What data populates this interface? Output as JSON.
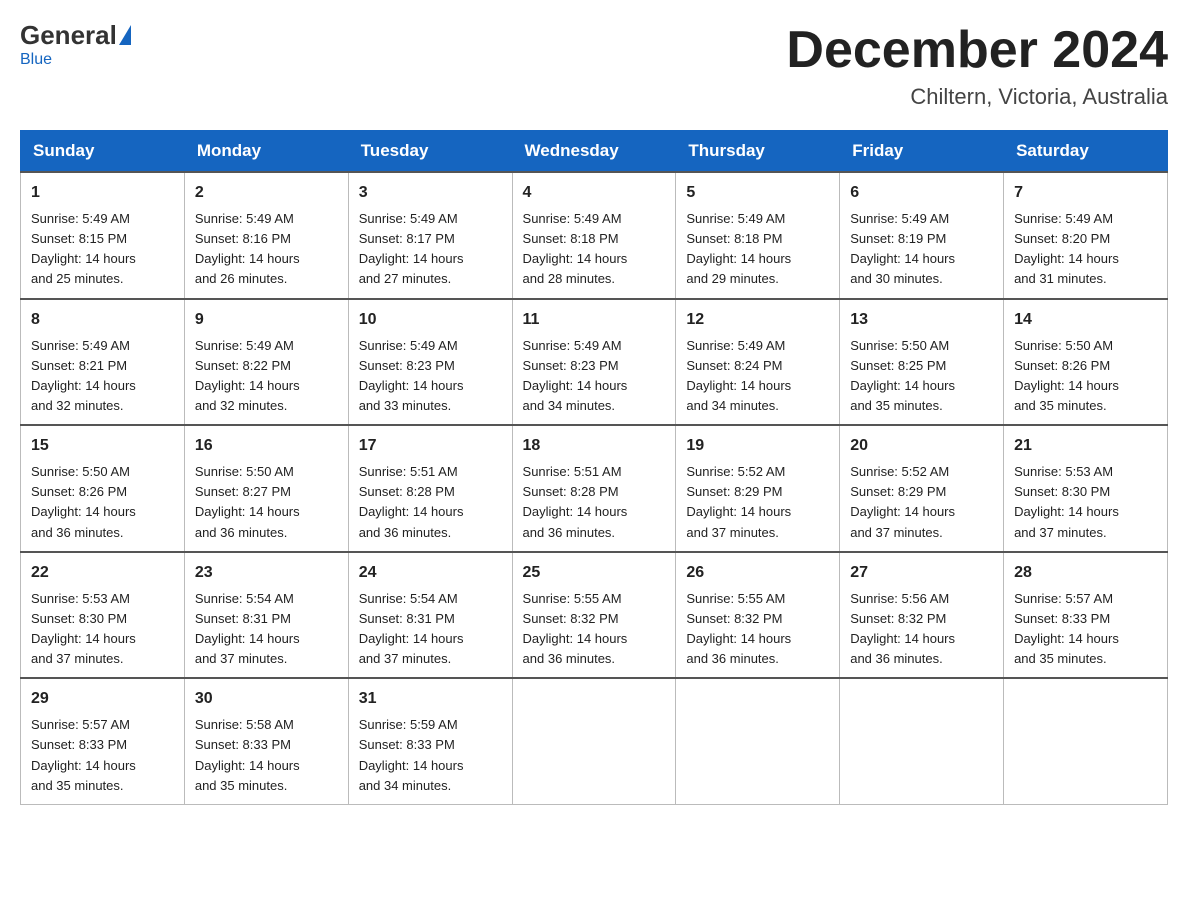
{
  "logo": {
    "general": "General",
    "blue": "Blue"
  },
  "title": "December 2024",
  "subtitle": "Chiltern, Victoria, Australia",
  "days_of_week": [
    "Sunday",
    "Monday",
    "Tuesday",
    "Wednesday",
    "Thursday",
    "Friday",
    "Saturday"
  ],
  "weeks": [
    [
      {
        "day": "1",
        "sunrise": "5:49 AM",
        "sunset": "8:15 PM",
        "daylight": "14 hours and 25 minutes."
      },
      {
        "day": "2",
        "sunrise": "5:49 AM",
        "sunset": "8:16 PM",
        "daylight": "14 hours and 26 minutes."
      },
      {
        "day": "3",
        "sunrise": "5:49 AM",
        "sunset": "8:17 PM",
        "daylight": "14 hours and 27 minutes."
      },
      {
        "day": "4",
        "sunrise": "5:49 AM",
        "sunset": "8:18 PM",
        "daylight": "14 hours and 28 minutes."
      },
      {
        "day": "5",
        "sunrise": "5:49 AM",
        "sunset": "8:18 PM",
        "daylight": "14 hours and 29 minutes."
      },
      {
        "day": "6",
        "sunrise": "5:49 AM",
        "sunset": "8:19 PM",
        "daylight": "14 hours and 30 minutes."
      },
      {
        "day": "7",
        "sunrise": "5:49 AM",
        "sunset": "8:20 PM",
        "daylight": "14 hours and 31 minutes."
      }
    ],
    [
      {
        "day": "8",
        "sunrise": "5:49 AM",
        "sunset": "8:21 PM",
        "daylight": "14 hours and 32 minutes."
      },
      {
        "day": "9",
        "sunrise": "5:49 AM",
        "sunset": "8:22 PM",
        "daylight": "14 hours and 32 minutes."
      },
      {
        "day": "10",
        "sunrise": "5:49 AM",
        "sunset": "8:23 PM",
        "daylight": "14 hours and 33 minutes."
      },
      {
        "day": "11",
        "sunrise": "5:49 AM",
        "sunset": "8:23 PM",
        "daylight": "14 hours and 34 minutes."
      },
      {
        "day": "12",
        "sunrise": "5:49 AM",
        "sunset": "8:24 PM",
        "daylight": "14 hours and 34 minutes."
      },
      {
        "day": "13",
        "sunrise": "5:50 AM",
        "sunset": "8:25 PM",
        "daylight": "14 hours and 35 minutes."
      },
      {
        "day": "14",
        "sunrise": "5:50 AM",
        "sunset": "8:26 PM",
        "daylight": "14 hours and 35 minutes."
      }
    ],
    [
      {
        "day": "15",
        "sunrise": "5:50 AM",
        "sunset": "8:26 PM",
        "daylight": "14 hours and 36 minutes."
      },
      {
        "day": "16",
        "sunrise": "5:50 AM",
        "sunset": "8:27 PM",
        "daylight": "14 hours and 36 minutes."
      },
      {
        "day": "17",
        "sunrise": "5:51 AM",
        "sunset": "8:28 PM",
        "daylight": "14 hours and 36 minutes."
      },
      {
        "day": "18",
        "sunrise": "5:51 AM",
        "sunset": "8:28 PM",
        "daylight": "14 hours and 36 minutes."
      },
      {
        "day": "19",
        "sunrise": "5:52 AM",
        "sunset": "8:29 PM",
        "daylight": "14 hours and 37 minutes."
      },
      {
        "day": "20",
        "sunrise": "5:52 AM",
        "sunset": "8:29 PM",
        "daylight": "14 hours and 37 minutes."
      },
      {
        "day": "21",
        "sunrise": "5:53 AM",
        "sunset": "8:30 PM",
        "daylight": "14 hours and 37 minutes."
      }
    ],
    [
      {
        "day": "22",
        "sunrise": "5:53 AM",
        "sunset": "8:30 PM",
        "daylight": "14 hours and 37 minutes."
      },
      {
        "day": "23",
        "sunrise": "5:54 AM",
        "sunset": "8:31 PM",
        "daylight": "14 hours and 37 minutes."
      },
      {
        "day": "24",
        "sunrise": "5:54 AM",
        "sunset": "8:31 PM",
        "daylight": "14 hours and 37 minutes."
      },
      {
        "day": "25",
        "sunrise": "5:55 AM",
        "sunset": "8:32 PM",
        "daylight": "14 hours and 36 minutes."
      },
      {
        "day": "26",
        "sunrise": "5:55 AM",
        "sunset": "8:32 PM",
        "daylight": "14 hours and 36 minutes."
      },
      {
        "day": "27",
        "sunrise": "5:56 AM",
        "sunset": "8:32 PM",
        "daylight": "14 hours and 36 minutes."
      },
      {
        "day": "28",
        "sunrise": "5:57 AM",
        "sunset": "8:33 PM",
        "daylight": "14 hours and 35 minutes."
      }
    ],
    [
      {
        "day": "29",
        "sunrise": "5:57 AM",
        "sunset": "8:33 PM",
        "daylight": "14 hours and 35 minutes."
      },
      {
        "day": "30",
        "sunrise": "5:58 AM",
        "sunset": "8:33 PM",
        "daylight": "14 hours and 35 minutes."
      },
      {
        "day": "31",
        "sunrise": "5:59 AM",
        "sunset": "8:33 PM",
        "daylight": "14 hours and 34 minutes."
      },
      null,
      null,
      null,
      null
    ]
  ],
  "labels": {
    "sunrise": "Sunrise:",
    "sunset": "Sunset:",
    "daylight": "Daylight:"
  }
}
